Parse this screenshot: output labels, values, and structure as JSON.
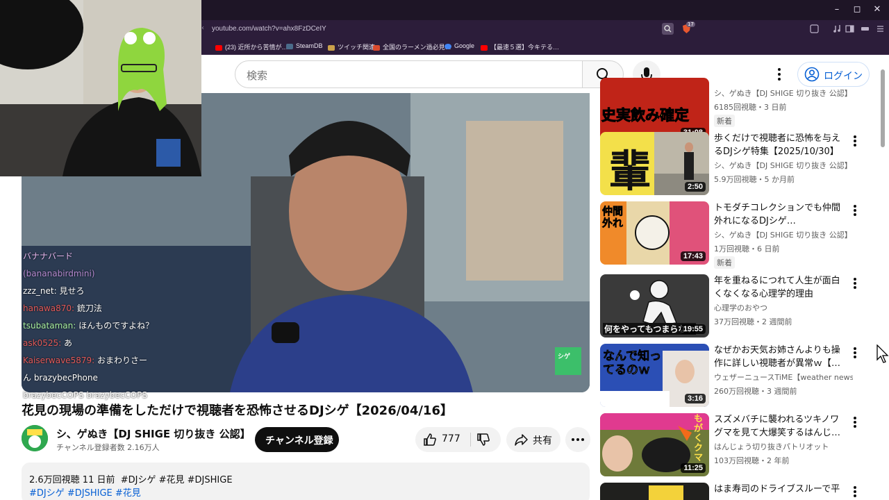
{
  "browser": {
    "url": "youtube.com/watch?v=ahx8FzDCeIY",
    "tab_count": "17",
    "bookmarks": [
      {
        "label": "(23) 近所から苦情が…",
        "color": "#ff0000"
      },
      {
        "label": "SteamDB",
        "color": "#1b2838"
      },
      {
        "label": "ツイッチ関連",
        "color": "#c9a04a"
      },
      {
        "label": "全国のラーメン過必見…",
        "color": "#d94a2e"
      },
      {
        "label": "Google",
        "color": "#4285f4"
      },
      {
        "label": "【最速５選】今キテる…",
        "color": "#ff0000"
      }
    ],
    "window_controls": {
      "minimize": "–",
      "maximize": "◻",
      "close": "✕"
    }
  },
  "youtube": {
    "search_placeholder": "検索",
    "login_label": "ログイン"
  },
  "video": {
    "title": "花見の現場の準備をしただけで視聴者を恐怖させるDJシゲ【2026/04/16】",
    "channel_name": "シ、ゲぬき【DJ SHIGE 切り抜き 公認】",
    "subscribers": "チャンネル登録者数 2.16万人",
    "subscribe_label": "チャンネル登録",
    "like_count": "777",
    "share_label": "共有",
    "views_date": "2.6万回視聴  11 日前",
    "tags_inline": "#DJシゲ #花見 #DJSHIGE",
    "tags_line2": "#DJシゲ #DJSHIGE #花見",
    "overlay_badge": "シゲ"
  },
  "chat": [
    {
      "name": "バナナバード",
      "text": ""
    },
    {
      "name": "(bananabirdmini)",
      "text": ""
    },
    {
      "name": "zzz_net:",
      "text": "見せろ"
    },
    {
      "name": "hanawa870:",
      "text": "銃刀法"
    },
    {
      "name": "tsubataman:",
      "text": "ほんものですよね？"
    },
    {
      "name": "ask0525:",
      "text": "あ"
    },
    {
      "name": "Kaiserwave5879:",
      "text": "おまわりさー"
    },
    {
      "name": "",
      "text": "ん brazybecPhone"
    },
    {
      "name": "",
      "text": "brazybecCOPS brazybecCOPS"
    }
  ],
  "recommendations": [
    {
      "title": "",
      "channel": "シ、ゲぬき【DJ SHIGE 切り抜き 公認】",
      "meta": "6185回視聴・3 日前",
      "badge": "新着",
      "duration": "31:08",
      "thumb_text": "史実飲み確定",
      "thumb_color": "#c02418"
    },
    {
      "title": "歩くだけで視聴者に恐怖を与えるDJシゲ特集【2025/10/30】",
      "channel": "シ、ゲぬき【DJ SHIGE 切り抜き 公認】",
      "meta": "5.9万回視聴・5 か月前",
      "badge": "",
      "duration": "2:50",
      "thumb_text": "輩",
      "thumb_color": "#f3e04a"
    },
    {
      "title": "トモダチコレクションでも仲間外れになるDJシゲ…",
      "channel": "シ、ゲぬき【DJ SHIGE 切り抜き 公認】",
      "meta": "1万回視聴・6 日前",
      "badge": "新着",
      "duration": "17:43",
      "thumb_text": "仲間外れ",
      "thumb_color": "#e9d7a9"
    },
    {
      "title": "年を重ねるにつれて人生が面白くなくなる心理学的理由",
      "channel": "心理学のおやつ",
      "meta": "37万回視聴・2 週間前",
      "badge": "",
      "duration": "19:55",
      "thumb_text": "何をやってもつまらない",
      "thumb_color": "#3a3a3a"
    },
    {
      "title": "なぜかお天気お姉さんよりも操作に詳しい視聴者が異常ｗ【…",
      "channel": "ウェザーニュースTiME【weather news li…",
      "meta": "260万回視聴・3 週間前",
      "badge": "",
      "duration": "3:16",
      "thumb_text": "なんで知ってるのｗ",
      "thumb_color": "#2b4fb5"
    },
    {
      "title": "スズメバチに襲われるツキノワグマを見て大爆笑するはんじ…",
      "channel": "はんじょう切り抜きパトリオット",
      "meta": "103万回視聴・2 年前",
      "badge": "",
      "duration": "11:25",
      "thumb_text": "もがくクマ",
      "thumb_color": "#e03a8f"
    },
    {
      "title": "はま寿司のドライブスルーで平",
      "channel": "",
      "meta": "",
      "badge": "",
      "duration": "",
      "thumb_text": "",
      "thumb_color": "#d8c9a2"
    }
  ],
  "colors": {
    "accent": "#065fd4",
    "chrome_bg": "#2c1d3a",
    "subscribe_bg": "#0f0f0f"
  }
}
